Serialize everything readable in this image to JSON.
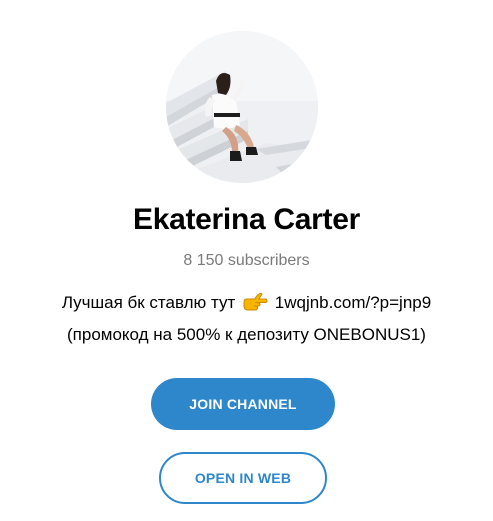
{
  "channel": {
    "name": "Ekaterina Carter",
    "subscribers": "8 150 subscribers",
    "description_before_emoji": "Лучшая бк ставлю тут",
    "description_emoji_icon": "pointing-hand-icon",
    "description_after_emoji": "1wqjnb.com/?p=jnp9",
    "description_line2": "(промокод на 500% к депозиту ONEBONUS1)"
  },
  "buttons": {
    "join_label": "JOIN CHANNEL",
    "web_label": "OPEN IN WEB"
  },
  "colors": {
    "accent": "#2e87ca",
    "subtitle_gray": "#7a7a7a",
    "emoji_yellow": "#f7b500"
  }
}
